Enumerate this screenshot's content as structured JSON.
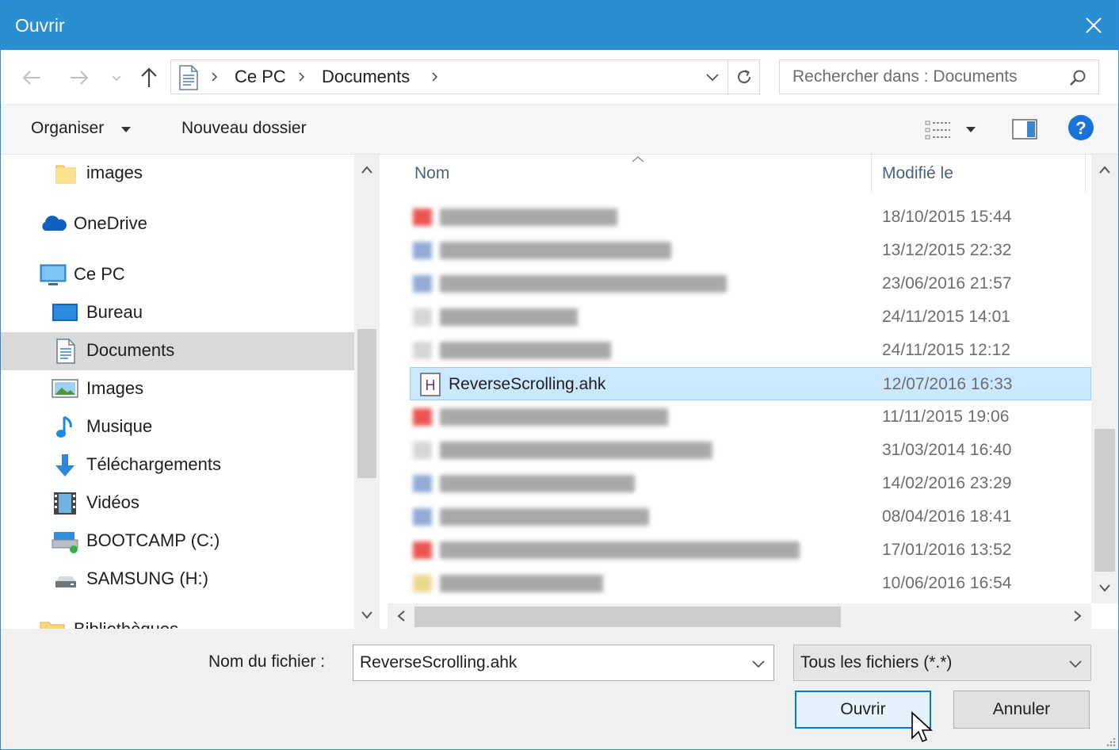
{
  "window": {
    "title": "Ouvrir"
  },
  "address": {
    "crumbs": [
      "Ce PC",
      "Documents"
    ]
  },
  "search": {
    "placeholder": "Rechercher dans : Documents"
  },
  "toolbar": {
    "organize": "Organiser",
    "new_folder": "Nouveau dossier"
  },
  "nav": {
    "items": [
      {
        "label": "images",
        "icon": "folder-icon"
      },
      {
        "label": "OneDrive",
        "icon": "onedrive-cloud-icon"
      },
      {
        "label": "Ce PC",
        "icon": "computer-icon"
      },
      {
        "label": "Bureau",
        "icon": "desktop-icon"
      },
      {
        "label": "Documents",
        "icon": "documents-icon",
        "selected": true
      },
      {
        "label": "Images",
        "icon": "pictures-icon"
      },
      {
        "label": "Musique",
        "icon": "music-icon"
      },
      {
        "label": "Téléchargements",
        "icon": "downloads-icon"
      },
      {
        "label": "Vidéos",
        "icon": "videos-icon"
      },
      {
        "label": "BOOTCAMP (C:)",
        "icon": "system-drive-icon"
      },
      {
        "label": "SAMSUNG (H:)",
        "icon": "drive-icon"
      },
      {
        "label": "Bibliothèques",
        "icon": "libraries-icon"
      }
    ]
  },
  "files": {
    "columns": {
      "name": "Nom",
      "modified": "Modifié le"
    },
    "rows": [
      {
        "date": "18/10/2015 15:44",
        "kind": "pdf"
      },
      {
        "date": "13/12/2015 22:32",
        "kind": "doc"
      },
      {
        "date": "23/06/2016 21:57",
        "kind": "doc"
      },
      {
        "date": "24/11/2015 14:01",
        "kind": "generic"
      },
      {
        "date": "24/11/2015 12:12",
        "kind": "generic"
      },
      {
        "date": "12/07/2016 16:33",
        "kind": "ahk",
        "name": "ReverseScrolling.ahk",
        "selected": true
      },
      {
        "date": "11/11/2015 19:06",
        "kind": "pdf"
      },
      {
        "date": "31/03/2014 16:40",
        "kind": "generic"
      },
      {
        "date": "14/02/2016 23:29",
        "kind": "doc"
      },
      {
        "date": "08/04/2016 18:41",
        "kind": "doc"
      },
      {
        "date": "17/01/2016 13:52",
        "kind": "pdf"
      },
      {
        "date": "10/06/2016 16:54",
        "kind": "folder"
      }
    ]
  },
  "bottom": {
    "filename_label": "Nom du fichier :",
    "filename_value": "ReverseScrolling.ahk",
    "filetype": "Tous les fichiers (*.*)",
    "open": "Ouvrir",
    "cancel": "Annuler"
  },
  "colors": {
    "titlebar": "#2b8ed0",
    "selection": "#cce8ff",
    "accent": "#0078d7"
  }
}
